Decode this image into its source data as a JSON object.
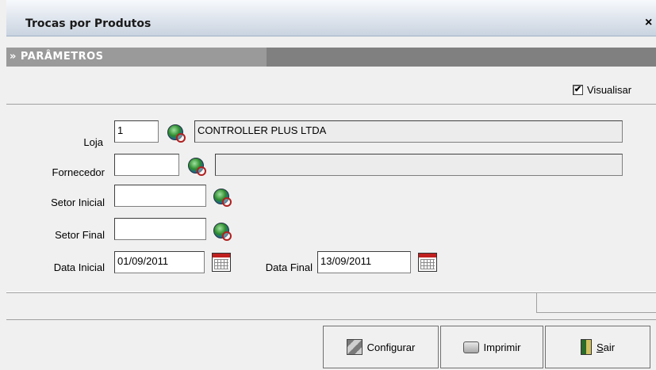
{
  "window": {
    "title": "Trocas por Produtos",
    "close_glyph": "×"
  },
  "section": {
    "label": "» PARÂMETROS"
  },
  "visualizar": {
    "label": "Visualisar",
    "checked": true,
    "check_glyph": "✔"
  },
  "form": {
    "loja": {
      "label": "Loja",
      "value": "1",
      "name_value": "CONTROLLER PLUS LTDA",
      "icon": "globe-search-icon"
    },
    "fornecedor": {
      "label": "Fornecedor",
      "value": "",
      "name_value": "",
      "icon": "globe-search-icon"
    },
    "setor_inicial": {
      "label": "Setor Inicial",
      "value": "",
      "icon": "globe-search-icon"
    },
    "setor_final": {
      "label": "Setor Final",
      "value": "",
      "icon": "globe-search-icon"
    },
    "data_inicial": {
      "label": "Data Inicial",
      "value": "01/09/2011",
      "icon": "calendar-icon"
    },
    "data_final": {
      "label": "Data Final",
      "value": "13/09/2011",
      "icon": "calendar-icon"
    }
  },
  "status": {
    "text": ""
  },
  "buttons": {
    "configurar": {
      "label": "Configurar",
      "icon": "configure-icon"
    },
    "imprimir": {
      "label": "Imprimir",
      "icon": "printer-icon"
    },
    "sair_prefix": "S",
    "sair_rest": "air",
    "sair_icon": "exit-door-icon"
  }
}
